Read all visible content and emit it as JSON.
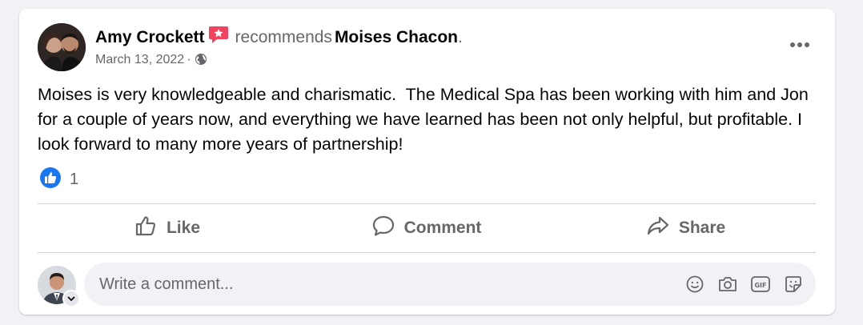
{
  "post": {
    "author": "Amy Crockett",
    "action": "recommends",
    "target": "Moises Chacon",
    "period": ".",
    "date": "March 13, 2022",
    "separator": "·",
    "privacy_icon": "globe-icon",
    "body": "Moises is very knowledgeable and charismatic.  The Medical Spa has been working with him and Jon for a couple of years now, and everything we have learned has been not only helpful, but profitable. I look forward to many more years of partnership!",
    "reactions": {
      "type": "like-reaction-icon",
      "count": "1"
    }
  },
  "actions": {
    "like": "Like",
    "comment": "Comment",
    "share": "Share"
  },
  "composer": {
    "placeholder": "Write a comment...",
    "icons": [
      "emoji-icon",
      "camera-icon",
      "gif-icon",
      "sticker-icon"
    ]
  },
  "colors": {
    "accent": "#1877f2",
    "recommend_badge": "#f3425f",
    "secondary_text": "#65676b",
    "divider": "#ced0d4"
  }
}
